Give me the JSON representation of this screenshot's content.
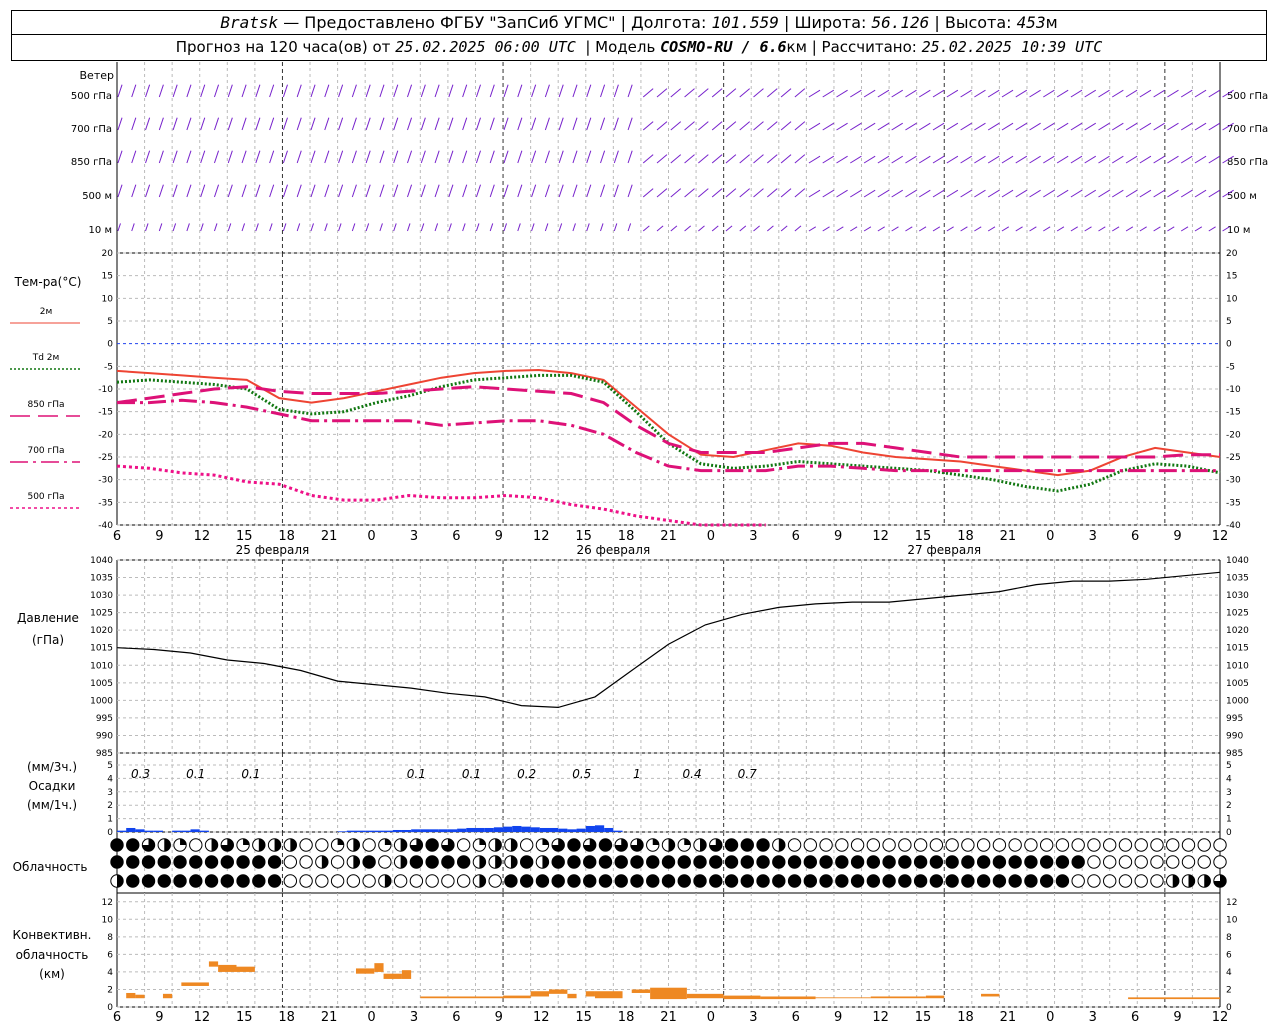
{
  "header": {
    "station": "Bratsk",
    "provider": "— Предоставлено ФГБУ \"ЗапСиб УГМС\"",
    "lon_label": "Долгота:",
    "lon_value": "101.559",
    "lat_label": "Широта:",
    "lat_value": "56.126",
    "alt_label": "Высота:",
    "alt_value": "453",
    "alt_unit": "м",
    "forecast_label": "Прогноз на 120 часа(ов) от",
    "forecast_start": "25.02.2025 06:00 UTC",
    "model_label": "Модель",
    "model_name": "COSMO-RU / 6.6",
    "model_unit": "км",
    "calc_label": "Рассчитано:",
    "calc_time": "25.02.2025 10:39 UTC"
  },
  "panels": {
    "wind": {
      "title": "Ветер",
      "levels": [
        "500 гПа",
        "700 гПа",
        "850 гПа",
        "500 м",
        "10  м"
      ]
    },
    "temperature": {
      "title": "Тем-ра(°С)",
      "legend": [
        "2м",
        "Td  2м",
        "850 гПа",
        "700 гПа",
        "500 гПа"
      ]
    },
    "pressure": {
      "title": "Давление",
      "unit": "(гПа)"
    },
    "precip": {
      "unit_top": "(мм/3ч.)",
      "title": "Осадки",
      "unit_bottom": "(мм/1ч.)",
      "labels": [
        "0.3",
        "0.1",
        "0.1",
        "0.1",
        "0.1",
        "0.2",
        "0.5",
        "1",
        "0.4",
        "0.7"
      ]
    },
    "clouds": {
      "title": "Облачность"
    },
    "convective": {
      "title_1": "Конвективн.",
      "title_2": "облачность",
      "unit": "(км)"
    }
  },
  "time_axis": {
    "hour_labels": [
      "6",
      "9",
      "12",
      "15",
      "18",
      "21",
      "0",
      "3",
      "6",
      "9",
      "12",
      "15",
      "18",
      "21",
      "0",
      "3",
      "6",
      "9",
      "12",
      "15",
      "18",
      "21",
      "0",
      "3",
      "6",
      "9",
      "12"
    ],
    "day_labels": [
      "25 февраля",
      "26 февраля",
      "27 февраля"
    ]
  },
  "colors": {
    "t2m": "#ee4433",
    "td2m": "#117711",
    "t850": "#dd1177",
    "t700": "#dd1177",
    "t500": "#ee1188",
    "wind": "#7722cc",
    "pressure": "#000000",
    "precip": "#1144ee",
    "convective": "#ee8822",
    "zero_line": "#2244ee"
  },
  "chart_data": {
    "type": "line",
    "x_hours": [
      0,
      3,
      6,
      9,
      12,
      15,
      18,
      21,
      24,
      27,
      30,
      33,
      36,
      39,
      42,
      45,
      48,
      51,
      54,
      57,
      60,
      63,
      66,
      69,
      72,
      75,
      78,
      81,
      84,
      87,
      90,
      93,
      96,
      99,
      102,
      105,
      108,
      111,
      114
    ],
    "temperature": {
      "ylim": [
        -40,
        20
      ],
      "yticks": [
        -40,
        -35,
        -30,
        -25,
        -20,
        -15,
        -10,
        -5,
        0,
        5,
        10,
        15,
        20
      ],
      "series": [
        {
          "name": "2м",
          "values": [
            -6,
            -6.5,
            -7,
            -7.5,
            -8,
            -12,
            -13,
            -12,
            -10.5,
            -9,
            -7.5,
            -6.5,
            -6,
            -5.8,
            -6.5,
            -8,
            -14,
            -20,
            -24.5,
            -25,
            -23.5,
            -22,
            -22.5,
            -24,
            -25,
            -25.5,
            -26,
            -27,
            -28,
            -29,
            -28,
            -25,
            -23,
            -24,
            -25
          ]
        },
        {
          "name": "Td  2м",
          "values": [
            -8.5,
            -8,
            -8.5,
            -9,
            -10,
            -14.5,
            -15.5,
            -15,
            -13,
            -11.5,
            -9.5,
            -8,
            -7.5,
            -7,
            -7,
            -8.5,
            -15,
            -22,
            -26.5,
            -27.5,
            -27,
            -26,
            -26.5,
            -27,
            -27.5,
            -28,
            -29,
            -30,
            -31.5,
            -32.5,
            -31,
            -28,
            -26.5,
            -27,
            -28.5
          ]
        },
        {
          "name": "850 гПа",
          "values": [
            -13,
            -12,
            -11,
            -10,
            -9.5,
            -10.5,
            -11,
            -11,
            -11,
            -10.5,
            -10,
            -9.5,
            -10,
            -10.5,
            -11,
            -13,
            -18,
            -22,
            -24,
            -24,
            -24,
            -23,
            -22,
            -22,
            -23,
            -24,
            -25,
            -25,
            -25,
            -25,
            -25,
            -25,
            -25,
            -24.5,
            -24.5
          ]
        },
        {
          "name": "700 гПа",
          "values": [
            -13,
            -13,
            -12.5,
            -13,
            -14,
            -15.5,
            -17,
            -17,
            -17,
            -17,
            -18,
            -17.5,
            -17,
            -17,
            -18,
            -20,
            -24,
            -27,
            -28,
            -28,
            -28,
            -27,
            -27,
            -27.5,
            -28,
            -28,
            -28,
            -28,
            -28,
            -28,
            -28,
            -28,
            -28,
            -28,
            -28
          ]
        },
        {
          "name": "500 гПа",
          "values": [
            -27,
            -27.5,
            -28.5,
            -29,
            -30.5,
            -31,
            -33.5,
            -34.5,
            -34.5,
            -33.5,
            -34,
            -34,
            -33.5,
            -34,
            -35.5,
            -36.5,
            -38,
            -39,
            -40,
            -40,
            -40,
            null,
            -40,
            null,
            null,
            null,
            null,
            null,
            null,
            null,
            null,
            null,
            null,
            null,
            null
          ]
        }
      ]
    },
    "pressure": {
      "ylim": [
        985,
        1040
      ],
      "yticks": [
        985,
        990,
        995,
        1000,
        1005,
        1010,
        1015,
        1020,
        1025,
        1030,
        1035,
        1040
      ],
      "values": [
        1015,
        1014.5,
        1013.5,
        1011.5,
        1010.5,
        1008.5,
        1005.5,
        1004.5,
        1003.5,
        1002,
        1001,
        998.5,
        998,
        1001,
        1008.5,
        1016,
        1021.5,
        1024.5,
        1026.5,
        1027.5,
        1028,
        1028,
        1029,
        1030,
        1031,
        1033,
        1034,
        1034,
        1034.5,
        1035.5,
        1036.5
      ]
    },
    "precipitation": {
      "ylim": [
        0,
        5
      ],
      "yticks": [
        0,
        1,
        2,
        3,
        4,
        5
      ],
      "hourly_mm": [
        0.1,
        0.3,
        0.2,
        0.1,
        0.1,
        0,
        0.1,
        0.1,
        0.2,
        0.1,
        0,
        0,
        0,
        0,
        0,
        0,
        0,
        0,
        0,
        0,
        0,
        0,
        0,
        0,
        0.05,
        0.1,
        0.1,
        0.1,
        0.1,
        0.1,
        0.15,
        0.15,
        0.2,
        0.2,
        0.2,
        0.2,
        0.2,
        0.25,
        0.3,
        0.3,
        0.3,
        0.35,
        0.4,
        0.45,
        0.4,
        0.35,
        0.3,
        0.3,
        0.25,
        0.2,
        0.25,
        0.45,
        0.5,
        0.3,
        0.1
      ],
      "labels_3h_hours": [
        3,
        9,
        15,
        33,
        39,
        45,
        51,
        57,
        63,
        69
      ],
      "labels_3h_values": [
        "0.3",
        "0.1",
        "0.1",
        "0.1",
        "0.1",
        "0.2",
        "0.5",
        "1",
        "0.4",
        "0.7"
      ]
    },
    "cloud_cover": {
      "rows": 3,
      "fractions": [
        [
          1,
          1,
          0.75,
          0.5,
          0.25,
          0,
          0.5,
          0.75,
          0.25,
          0.5,
          0.5,
          0.5,
          0,
          0,
          0.25,
          0.5,
          0,
          0.25,
          0.5,
          0.75,
          1,
          0.75,
          0,
          0.25,
          0.5,
          0.5,
          0,
          0.25,
          0.75,
          1,
          0.75,
          1,
          0.75,
          0.75,
          0.25,
          0.5,
          0.25,
          0.5,
          0.75,
          1,
          1,
          1,
          0.5,
          0,
          0,
          0,
          0,
          0,
          0,
          0,
          0,
          0,
          0,
          0,
          0,
          0,
          0,
          0,
          0,
          0,
          0,
          0,
          0,
          0,
          0,
          0,
          0,
          0,
          0,
          0,
          0,
          0,
          0,
          0,
          0,
          0,
          0,
          0,
          0,
          0,
          0,
          0,
          0,
          0,
          0,
          0,
          0,
          0,
          0,
          0,
          0,
          0,
          0,
          0,
          0,
          0,
          0,
          0,
          0,
          0,
          0,
          0,
          0,
          0,
          0,
          0,
          0,
          0,
          0,
          0,
          0,
          0,
          0,
          0,
          0,
          0,
          0
        ],
        [
          1,
          1,
          1,
          1,
          1,
          1,
          1,
          1,
          1,
          1,
          1,
          0,
          0,
          0.5,
          0,
          0.5,
          1,
          0,
          0.5,
          1,
          1,
          1,
          1,
          0.5,
          0.5,
          0.5,
          1,
          0.5,
          1,
          1,
          1,
          1,
          1,
          1,
          1,
          1,
          1,
          1,
          1,
          1,
          1,
          1,
          1,
          1,
          1,
          1,
          1,
          1,
          1,
          1,
          1,
          1,
          1,
          1,
          1,
          1,
          1,
          1,
          1,
          1,
          1,
          1,
          0,
          0,
          0,
          0,
          0,
          0,
          0,
          0,
          0,
          0,
          0,
          0,
          0,
          0,
          0,
          0,
          0,
          0,
          0,
          0,
          0,
          0,
          0,
          0,
          0,
          0,
          0,
          0,
          0,
          0,
          0,
          0,
          0,
          0,
          0,
          0,
          0,
          0,
          0,
          0,
          0,
          0,
          0,
          0,
          0,
          0,
          0,
          0,
          0,
          0,
          0,
          0,
          0,
          0,
          0
        ],
        [
          0.5,
          1,
          1,
          1,
          1,
          1,
          1,
          1,
          1,
          1,
          1,
          0,
          0,
          0,
          0,
          0,
          0,
          0.5,
          0,
          0,
          0,
          0,
          0,
          0.5,
          0,
          1,
          1,
          1,
          1,
          1,
          1,
          1,
          1,
          1,
          1,
          1,
          1,
          1,
          1,
          1,
          1,
          1,
          1,
          1,
          1,
          1,
          1,
          1,
          1,
          1,
          1,
          1,
          1,
          1,
          1,
          1,
          1,
          1,
          1,
          1,
          1,
          0,
          0,
          0,
          0,
          0,
          0,
          0.5,
          0.5,
          0.5,
          0.75,
          0.5,
          0.5,
          0.5,
          0,
          0.5,
          0,
          0,
          0,
          0,
          0,
          0.5,
          0,
          0,
          0,
          0.5,
          0,
          0,
          0,
          0,
          0,
          0,
          0,
          0,
          0,
          0,
          0,
          0,
          0,
          0,
          0,
          0,
          0,
          0,
          0,
          0,
          0,
          0,
          0,
          0,
          0,
          0,
          0,
          0,
          0,
          0,
          0,
          0,
          0
        ]
      ]
    },
    "convective_clouds": {
      "ylim": [
        0,
        13
      ],
      "yticks": [
        0,
        2,
        4,
        6,
        8,
        10,
        12
      ],
      "segments": [
        [
          1,
          2,
          1.0,
          1.6
        ],
        [
          2,
          3,
          1.0,
          1.4
        ],
        [
          5,
          6,
          1.0,
          1.5
        ],
        [
          7,
          10,
          2.4,
          2.8
        ],
        [
          10,
          11,
          4.6,
          5.2
        ],
        [
          11,
          13,
          4.0,
          4.8
        ],
        [
          13,
          15,
          4.0,
          4.6
        ],
        [
          26,
          28,
          3.8,
          4.4
        ],
        [
          28,
          29,
          4.0,
          5.0
        ],
        [
          29,
          31,
          3.2,
          3.8
        ],
        [
          31,
          32,
          3.2,
          4.2
        ],
        [
          33,
          36,
          1.0,
          1.2
        ],
        [
          36,
          42,
          1.0,
          1.2
        ],
        [
          42,
          45,
          1.0,
          1.3
        ],
        [
          45,
          47,
          1.2,
          1.8
        ],
        [
          47,
          49,
          1.5,
          2.0
        ],
        [
          49,
          50,
          1.0,
          1.5
        ],
        [
          51,
          52,
          1.2,
          1.8
        ],
        [
          52,
          55,
          1.0,
          1.8
        ],
        [
          56,
          58,
          1.6,
          2.0
        ],
        [
          58,
          62,
          0.9,
          2.2
        ],
        [
          62,
          66,
          1.0,
          1.5
        ],
        [
          66,
          70,
          0.9,
          1.3
        ],
        [
          70,
          76,
          0.9,
          1.2
        ],
        [
          76,
          82,
          1.0,
          1.1
        ],
        [
          82,
          88,
          1.0,
          1.2
        ],
        [
          88,
          90,
          1.0,
          1.3
        ],
        [
          94,
          96,
          1.2,
          1.5
        ],
        [
          110,
          120,
          0.9,
          1.1
        ]
      ]
    }
  }
}
